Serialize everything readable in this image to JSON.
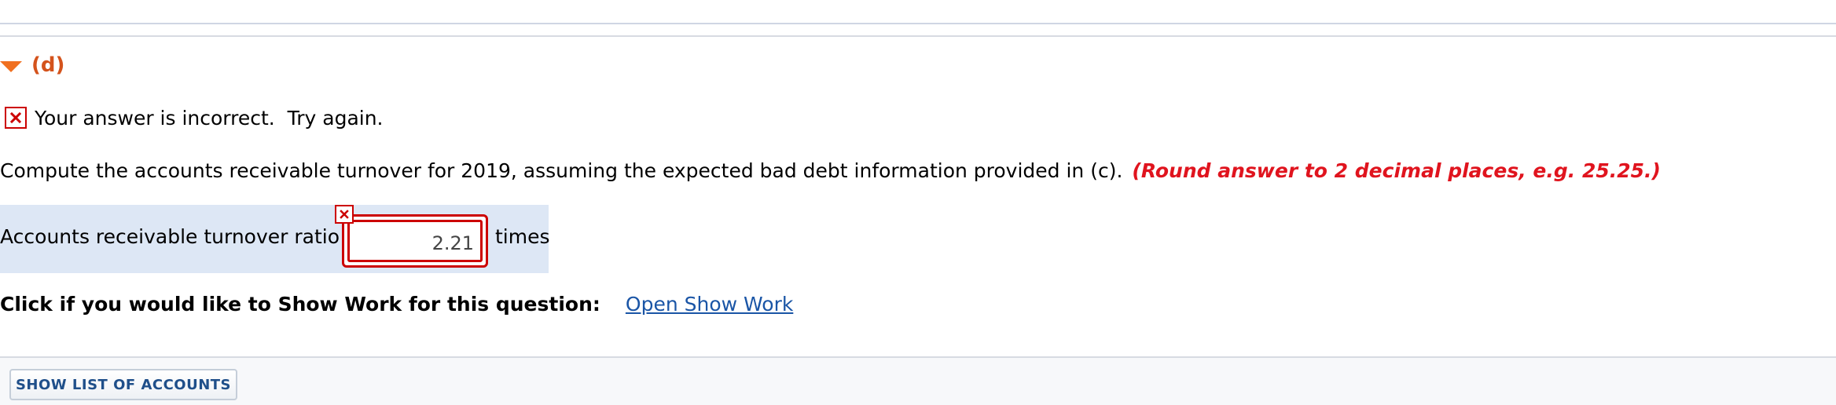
{
  "section": {
    "part_label": "(d)"
  },
  "feedback": {
    "message": "Your answer is incorrect.  Try again."
  },
  "question": {
    "text": "Compute the accounts receivable turnover for 2019, assuming the expected bad debt information provided in (c).",
    "instruction": "(Round answer to 2 decimal places, e.g. 25.25.)"
  },
  "answer": {
    "label": "Accounts receivable turnover ratio",
    "value": "2.21",
    "unit": "times",
    "status": "incorrect"
  },
  "show_work": {
    "prompt": "Click if you would like to Show Work for this question:",
    "link_label": "Open Show Work"
  },
  "footer": {
    "accounts_button_label": "SHOW LIST OF ACCOUNTS"
  },
  "colors": {
    "accent_orange": "#f07020",
    "part_label": "#d4531c",
    "error_red": "#cc0000",
    "instruction_red": "#e0141e",
    "answer_row_bg": "#dde7f5",
    "link_blue": "#1a55a6"
  },
  "icons": {
    "section_toggle": "caret-down-icon",
    "feedback": "incorrect-x-icon",
    "input_status": "incorrect-x-icon"
  }
}
